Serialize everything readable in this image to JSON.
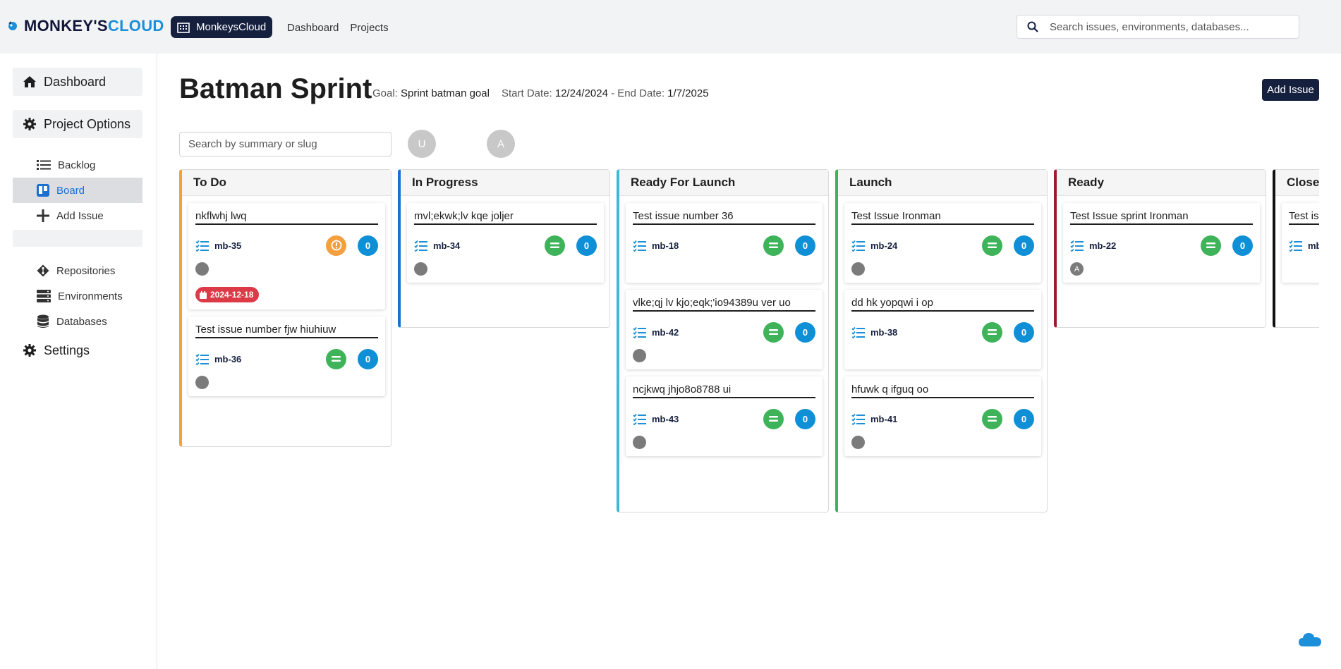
{
  "brand": {
    "logo_main": "MONKEY'S",
    "logo_accent": "CLOUD",
    "org_name": "MonkeysCloud"
  },
  "topnav": {
    "items": [
      "Dashboard",
      "Projects"
    ]
  },
  "search": {
    "placeholder": "Search issues, environments, databases..."
  },
  "sidebar": {
    "dashboard": "Dashboard",
    "project_options": "Project Options",
    "items": [
      {
        "label": "Backlog",
        "icon": "list-icon"
      },
      {
        "label": "Board",
        "icon": "board-icon",
        "active": true
      },
      {
        "label": "Add Issue",
        "icon": "plus-icon"
      }
    ],
    "resources": [
      {
        "label": "Repositories",
        "icon": "git-icon"
      },
      {
        "label": "Environments",
        "icon": "server-icon"
      },
      {
        "label": "Databases",
        "icon": "database-icon"
      }
    ],
    "settings": "Settings"
  },
  "sprint": {
    "title": "Batman Sprint",
    "goal_label": "Goal:",
    "goal": "Sprint batman goal",
    "start_label": "Start Date:",
    "start": "12/24/2024",
    "end_label": "- End Date:",
    "end": "1/7/2025",
    "add_issue": "Add Issue"
  },
  "board_search": {
    "placeholder": "Search by summary or slug"
  },
  "filter_avatars": [
    "U",
    "A"
  ],
  "colors": {
    "todo": "#f59f3e",
    "in_progress": "#1b6fd1",
    "ready_for_launch": "#3bbad8",
    "launch": "#3fb35a",
    "ready": "#9e1b2b",
    "closed": "#111111"
  },
  "columns": [
    {
      "title": "To Do",
      "color": "#f59f3e",
      "cards": [
        {
          "summary": "nkflwhj lwq",
          "slug": "mb-35",
          "priority": "high",
          "points": "0",
          "assignee": "",
          "due": "2024-12-18"
        },
        {
          "summary": "Test issue number fjw hiuhiuw",
          "slug": "mb-36",
          "priority": "normal",
          "points": "0",
          "assignee": ""
        }
      ]
    },
    {
      "title": "In Progress",
      "color": "#1b6fd1",
      "cards": [
        {
          "summary": "mvl;ekwk;lv kqe joljer",
          "slug": "mb-34",
          "priority": "normal",
          "points": "0",
          "assignee": ""
        }
      ]
    },
    {
      "title": "Ready For Launch",
      "color": "#3bbad8",
      "cards": [
        {
          "summary": "Test issue number 36",
          "slug": "mb-18",
          "priority": "normal",
          "points": "0"
        },
        {
          "summary": "vlke;qj lv kjo;eqk;'io94389u ver uo",
          "slug": "mb-42",
          "priority": "normal",
          "points": "0",
          "assignee": ""
        },
        {
          "summary": "ncjkwq jhjo8o8788 ui",
          "slug": "mb-43",
          "priority": "normal",
          "points": "0",
          "assignee": ""
        }
      ]
    },
    {
      "title": "Launch",
      "color": "#3fb35a",
      "cards": [
        {
          "summary": "Test Issue Ironman",
          "slug": "mb-24",
          "priority": "normal",
          "points": "0",
          "assignee": ""
        },
        {
          "summary": "dd hk yopqwi i op",
          "slug": "mb-38",
          "priority": "normal",
          "points": "0"
        },
        {
          "summary": "hfuwk q ifguq oo",
          "slug": "mb-41",
          "priority": "normal",
          "points": "0",
          "assignee": ""
        }
      ]
    },
    {
      "title": "Ready",
      "color": "#9e1b2b",
      "cards": [
        {
          "summary": "Test Issue sprint Ironman",
          "slug": "mb-22",
          "priority": "normal",
          "points": "0",
          "assignee": "A"
        }
      ]
    },
    {
      "title": "Closed",
      "color": "#111111",
      "cards": [
        {
          "summary": "Test issue",
          "slug": "mb",
          "priority": "normal",
          "points": "0"
        }
      ]
    }
  ]
}
